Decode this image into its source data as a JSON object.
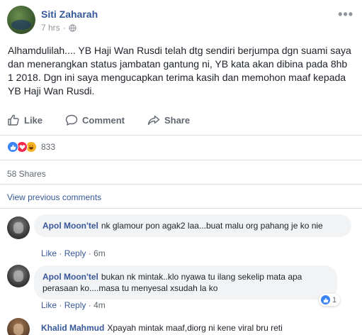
{
  "post": {
    "author": "Siti Zaharah",
    "time": "7 hrs",
    "separator": "·",
    "privacy_icon": "globe-icon",
    "text": "Alhamdulilah.... YB Haji Wan Rusdi telah dtg sendiri berjumpa dgn suami saya dan menerangkan status jambatan gantung ni, YB kata akan dibina pada 8hb 1 2018. Dgn ini saya mengucapkan terima kasih dan memohon maaf kepada YB Haji Wan Rusdi.",
    "more_icon": "more-options-icon"
  },
  "actions": {
    "like": "Like",
    "comment": "Comment",
    "share": "Share"
  },
  "reactions": {
    "count": "833",
    "types": [
      "like",
      "love",
      "haha"
    ]
  },
  "shares": "58 Shares",
  "view_previous": "View previous comments",
  "comments": [
    {
      "name": "Apol Moon'tel",
      "text": "nk glamour pon agak2 laa...buat malu org pahang je ko nie",
      "like": "Like",
      "reply": "Reply",
      "dot": "·",
      "time": "6m"
    },
    {
      "name": "Apol Moon'tel",
      "text": "bukan nk mintak..klo nyawa tu ilang sekelip mata apa perasaan ko....masa tu menyesal xsudah la ko",
      "like": "Like",
      "reply": "Reply",
      "dot": "·",
      "time": "4m",
      "like_count": "1"
    },
    {
      "name": "Khalid Mahmud",
      "text": "Xpayah mintak maaf,diorg ni kene viral bru reti"
    }
  ],
  "colors": {
    "link": "#385898",
    "author": "#365899",
    "secondary": "#606770",
    "bubble": "#f2f3f5"
  }
}
